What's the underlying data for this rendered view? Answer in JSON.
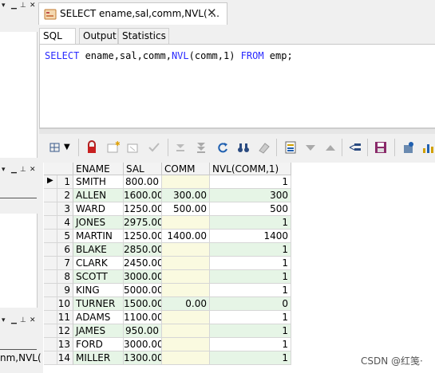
{
  "document_tab": {
    "title": "SELECT ename,sal,comm,NVL( ...",
    "close_glyph": "✕"
  },
  "sub_tabs": [
    {
      "label": "SQL",
      "active": true
    },
    {
      "label": "Output",
      "active": false
    },
    {
      "label": "Statistics",
      "active": false
    }
  ],
  "editor": {
    "tokens": [
      {
        "text": "SELECT",
        "kw": true
      },
      {
        "text": " ename,sal,comm,",
        "kw": false
      },
      {
        "text": "NVL",
        "kw": true
      },
      {
        "text": "(comm,1) ",
        "kw": false
      },
      {
        "text": "FROM",
        "kw": true
      },
      {
        "text": " emp;",
        "kw": false
      }
    ]
  },
  "left_panels": {
    "bottom_partial_text": "nm,NVL("
  },
  "grid": {
    "columns": [
      "ENAME",
      "SAL",
      "COMM",
      "NVL(COMM,1)"
    ],
    "rows": [
      {
        "n": "1",
        "ename": "SMITH",
        "sal": "800.00",
        "comm": "",
        "nvl": "1"
      },
      {
        "n": "2",
        "ename": "ALLEN",
        "sal": "1600.00",
        "comm": "300.00",
        "nvl": "300"
      },
      {
        "n": "3",
        "ename": "WARD",
        "sal": "1250.00",
        "comm": "500.00",
        "nvl": "500"
      },
      {
        "n": "4",
        "ename": "JONES",
        "sal": "2975.00",
        "comm": "",
        "nvl": "1"
      },
      {
        "n": "5",
        "ename": "MARTIN",
        "sal": "1250.00",
        "comm": "1400.00",
        "nvl": "1400"
      },
      {
        "n": "6",
        "ename": "BLAKE",
        "sal": "2850.00",
        "comm": "",
        "nvl": "1"
      },
      {
        "n": "7",
        "ename": "CLARK",
        "sal": "2450.00",
        "comm": "",
        "nvl": "1"
      },
      {
        "n": "8",
        "ename": "SCOTT",
        "sal": "3000.00",
        "comm": "",
        "nvl": "1"
      },
      {
        "n": "9",
        "ename": "KING",
        "sal": "5000.00",
        "comm": "",
        "nvl": "1"
      },
      {
        "n": "10",
        "ename": "TURNER",
        "sal": "1500.00",
        "comm": "0.00",
        "nvl": "0"
      },
      {
        "n": "11",
        "ename": "ADAMS",
        "sal": "1100.00",
        "comm": "",
        "nvl": "1"
      },
      {
        "n": "12",
        "ename": "JAMES",
        "sal": "950.00",
        "comm": "",
        "nvl": "1"
      },
      {
        "n": "13",
        "ename": "FORD",
        "sal": "3000.00",
        "comm": "",
        "nvl": "1"
      },
      {
        "n": "14",
        "ename": "MILLER",
        "sal": "1300.00",
        "comm": "",
        "nvl": "1"
      }
    ]
  },
  "watermark": "CSDN @红笺·",
  "colors": {
    "keyword": "#2a2aff",
    "row_alt": "#e6f5e6",
    "null_cell": "#fafae0"
  }
}
